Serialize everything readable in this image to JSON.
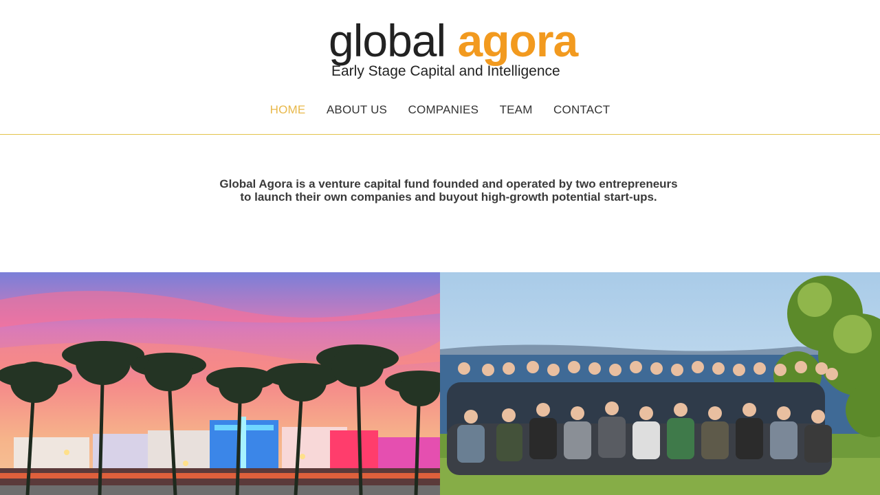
{
  "logo": {
    "word1": "global",
    "word2": "agora",
    "tagline": "Early Stage Capital and Intelligence"
  },
  "nav": {
    "items": [
      {
        "label": "HOME",
        "active": true
      },
      {
        "label": "ABOUT US",
        "active": false
      },
      {
        "label": "COMPANIES",
        "active": false
      },
      {
        "label": "TEAM",
        "active": false
      },
      {
        "label": "CONTACT",
        "active": false
      }
    ]
  },
  "intro": {
    "line1": "Global Agora is a venture capital fund founded and operated by two entrepreneurs",
    "line2": "to launch their own companies and buyout high-growth potential start-ups."
  },
  "colors": {
    "accent": "#e8b84a",
    "logo_orange": "#f29a1f",
    "divider": "#e3c34a",
    "text": "#3a3a3a"
  }
}
